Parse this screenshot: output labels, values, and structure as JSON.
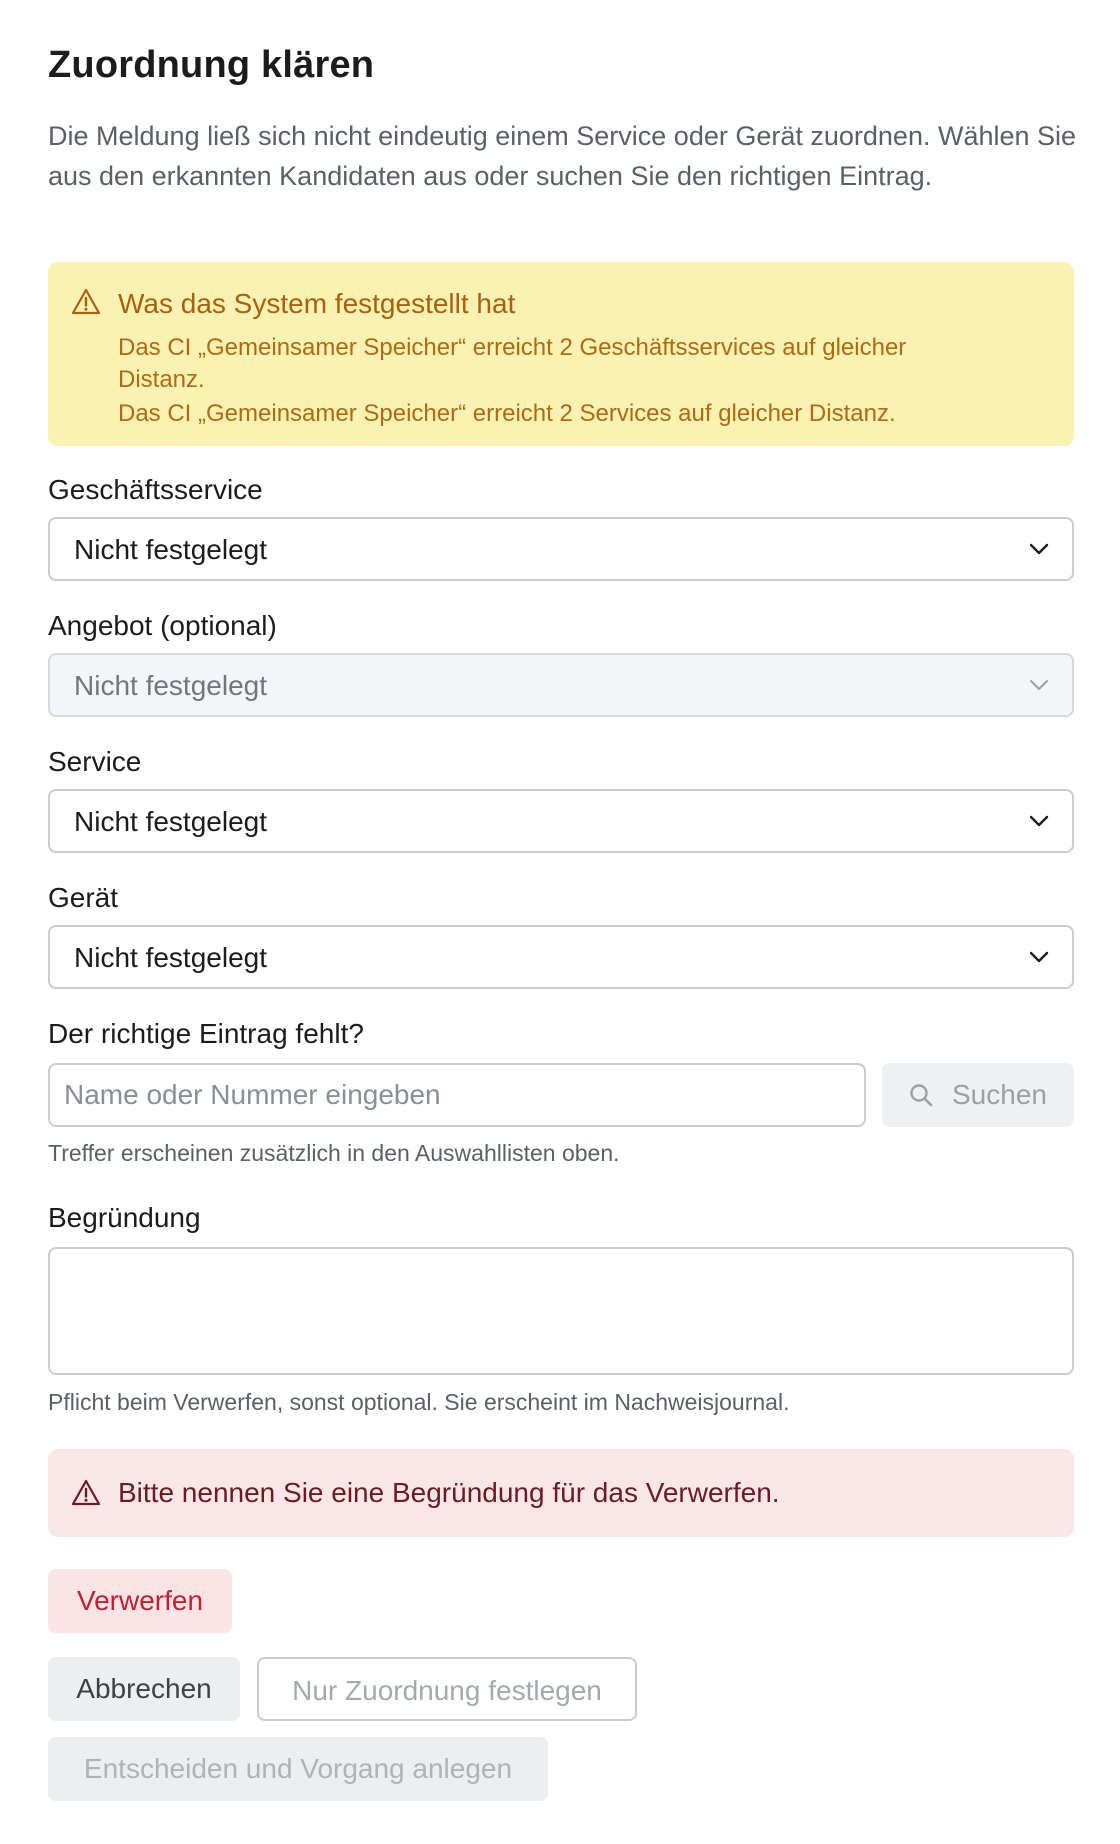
{
  "dialog": {
    "title": "Zuordnung klären",
    "intro": "Die Meldung ließ sich nicht eindeutig einem Service oder Gerät zuordnen. Wählen Sie aus den erkannten Kandidaten aus oder suchen Sie den richtigen Eintrag."
  },
  "notice": {
    "title": "Was das System festgestellt hat",
    "line1": "Das CI „Gemeinsamer Speicher“ erreicht 2 Geschäftsservices auf gleicher",
    "line1b": "Distanz.",
    "line2": "Das CI „Gemeinsamer Speicher“ erreicht 2 Services auf gleicher Distanz.",
    "icon": "warning-triangle-icon",
    "color": "#a9620b",
    "background": "#fbf1b3"
  },
  "fields": {
    "business_service": {
      "label": "Geschäftsservice",
      "value": "Nicht festgelegt"
    },
    "offering": {
      "label": "Angebot (optional)",
      "value": "Nicht festgelegt",
      "disabled": true
    },
    "service": {
      "label": "Service",
      "value": "Nicht festgelegt"
    },
    "device": {
      "label": "Gerät",
      "value": "Nicht festgelegt"
    }
  },
  "search": {
    "label": "Der richtige Eintrag fehlt?",
    "placeholder": "Name oder Nummer eingeben",
    "value": "",
    "button_label": "Suchen",
    "help": "Treffer erscheinen zusätzlich in den Auswahllisten oben."
  },
  "reason": {
    "label": "Begründung",
    "value": "",
    "help": "Pflicht beim Verwerfen, sonst optional. Sie erscheint im Nachweisjournal."
  },
  "error": {
    "text": "Bitte nennen Sie eine Begründung für das Verwerfen.",
    "icon": "warning-triangle-icon",
    "color": "#6b1b22",
    "background": "#fbe6e7"
  },
  "actions": {
    "discard": "Verwerfen",
    "cancel": "Abbrechen",
    "assign_only": "Nur Zuordnung festlegen",
    "decide": "Entscheiden und Vorgang anlegen"
  },
  "colors": {
    "danger": "#c6202e",
    "border": "#c9ccd1",
    "muted_text": "#5b6068"
  }
}
